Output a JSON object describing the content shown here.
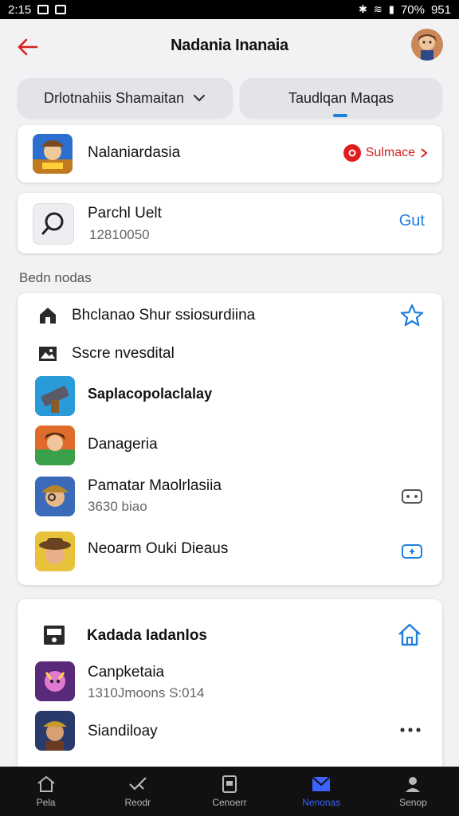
{
  "status_bar": {
    "time": "2:15",
    "right_text": "70% ⁝951",
    "battery": "70%",
    "clock_right": "951"
  },
  "header": {
    "title": "Nadania Inanaia"
  },
  "tabs": [
    {
      "label": "Drlotnahiis Shamaitan"
    },
    {
      "label": "Taudlqan Maqas"
    }
  ],
  "featured": {
    "title": "Nalaniardasia",
    "link_label": "Sulmace"
  },
  "search_card": {
    "title": "Parchl Uelt",
    "subtitle": "12810050",
    "action_label": "Gut"
  },
  "section_label": "Bedn nodas",
  "list_items": [
    {
      "title": "Bhclanao Shur ssiosurdiina",
      "subtitle": "",
      "trailing_icon": "star-icon"
    },
    {
      "title": "Sscre nvesdital",
      "subtitle": "",
      "trailing_icon": ""
    },
    {
      "title": "Saplacopolaclalay",
      "subtitle": "",
      "trailing_icon": ""
    },
    {
      "title": "Danageria",
      "subtitle": "",
      "trailing_icon": ""
    },
    {
      "title": "Pamatar Maolrlasiia",
      "subtitle": "3630 biao",
      "trailing_icon": "gamepad-icon"
    },
    {
      "title": "Neoarm Ouki Dieaus",
      "subtitle": "",
      "trailing_icon": "gamepad-icon"
    }
  ],
  "card4": {
    "header_title": "Kadada Iadanlos",
    "items": [
      {
        "title": "Canpketaia",
        "subtitle": "1310Jmoons S:014",
        "trailing_icon": ""
      },
      {
        "title": "Siandiloay",
        "subtitle": "",
        "trailing_icon": "more-icon"
      }
    ]
  },
  "bottom_nav": [
    {
      "label": "Pela",
      "icon": "home-icon",
      "active": false
    },
    {
      "label": "Reodr",
      "icon": "check-icon",
      "active": false
    },
    {
      "label": "Cenoerr",
      "icon": "clipboard-icon",
      "active": false
    },
    {
      "label": "Nenonas",
      "icon": "envelope-icon",
      "active": true
    },
    {
      "label": "Senop",
      "icon": "person-icon",
      "active": false
    }
  ],
  "colors": {
    "accent_blue": "#1d7fe0",
    "accent_red": "#d61f1f",
    "nav_active": "#3a63ff"
  }
}
